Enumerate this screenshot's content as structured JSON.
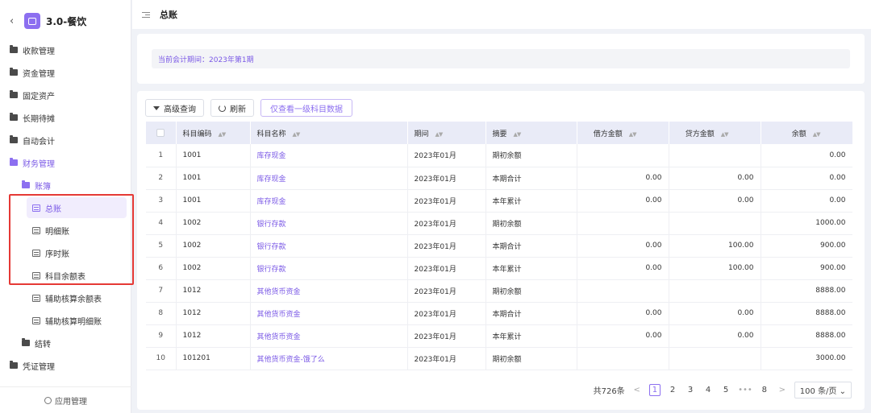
{
  "app": {
    "back_icon": "‹",
    "title": "3.0-餐饮"
  },
  "sidebar": {
    "items": [
      {
        "label": "收款管理"
      },
      {
        "label": "资金管理"
      },
      {
        "label": "固定资产"
      },
      {
        "label": "长期待摊"
      },
      {
        "label": "自动会计"
      },
      {
        "label": "财务管理"
      },
      {
        "label": "账簿"
      },
      {
        "label": "总账"
      },
      {
        "label": "明细账"
      },
      {
        "label": "序时账"
      },
      {
        "label": "科目余额表"
      },
      {
        "label": "辅助核算余额表"
      },
      {
        "label": "辅助核算明细账"
      },
      {
        "label": "结转"
      },
      {
        "label": "凭证管理"
      }
    ],
    "footer": "应用管理"
  },
  "header": {
    "title": "总账"
  },
  "period": {
    "text": "当前会计期间：2023年第1期"
  },
  "toolbar": {
    "advanced": "高级查询",
    "refresh": "刷新",
    "level1": "仅查看一级科目数据"
  },
  "table": {
    "columns": [
      "科目编码",
      "科目名称",
      "期间",
      "摘要",
      "借方金额",
      "贷方金额",
      "余额"
    ],
    "rows": [
      [
        "1",
        "1001",
        "库存现金",
        "2023年01月",
        "期初余额",
        "",
        "",
        "0.00"
      ],
      [
        "2",
        "1001",
        "库存现金",
        "2023年01月",
        "本期合计",
        "0.00",
        "0.00",
        "0.00"
      ],
      [
        "3",
        "1001",
        "库存现金",
        "2023年01月",
        "本年累计",
        "0.00",
        "0.00",
        "0.00"
      ],
      [
        "4",
        "1002",
        "银行存款",
        "2023年01月",
        "期初余额",
        "",
        "",
        "1000.00"
      ],
      [
        "5",
        "1002",
        "银行存款",
        "2023年01月",
        "本期合计",
        "0.00",
        "100.00",
        "900.00"
      ],
      [
        "6",
        "1002",
        "银行存款",
        "2023年01月",
        "本年累计",
        "0.00",
        "100.00",
        "900.00"
      ],
      [
        "7",
        "1012",
        "其他货币资金",
        "2023年01月",
        "期初余额",
        "",
        "",
        "8888.00"
      ],
      [
        "8",
        "1012",
        "其他货币资金",
        "2023年01月",
        "本期合计",
        "0.00",
        "0.00",
        "8888.00"
      ],
      [
        "9",
        "1012",
        "其他货币资金",
        "2023年01月",
        "本年累计",
        "0.00",
        "0.00",
        "8888.00"
      ],
      [
        "10",
        "101201",
        "其他货币资金-饿了么",
        "2023年01月",
        "期初余额",
        "",
        "",
        "3000.00"
      ]
    ]
  },
  "pagination": {
    "total": "共726条",
    "prev": "<",
    "pages": [
      "1",
      "2",
      "3",
      "4",
      "5"
    ],
    "ellipsis": "•••",
    "last": "8",
    "next": ">",
    "size": "100 条/页 ⌄"
  },
  "colors": {
    "accent": "#8c6ff0",
    "highlight_box": "#e53935"
  }
}
